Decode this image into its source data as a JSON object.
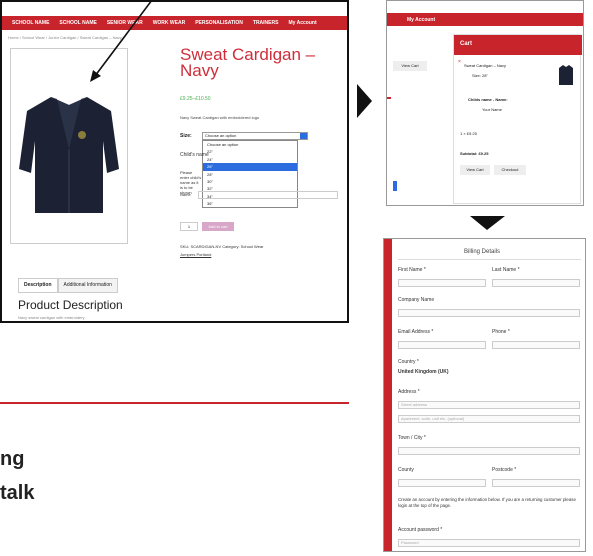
{
  "panel1": {
    "nav": [
      "SCHOOL NAME",
      "SCHOOL NAME",
      "SENIOR WEAR",
      "WORK WEAR",
      "PERSONALISATION",
      "TRAINERS",
      "My Account"
    ],
    "breadcrumb": "Home / School Wear / Junior Cardigan / Sweat Cardigan – Navy",
    "product_title": "Sweat Cardigan – Navy",
    "price": "£9.25–£10.50",
    "short_desc": "Navy Sweat Cardigan with embroidered logo",
    "size_label": "Size:",
    "size_select_value": "Choose an option",
    "size_options": [
      "Choose an option",
      "22\"",
      "24\"",
      "26\"",
      "28\"",
      "30\"",
      "32\"",
      "34\"",
      "36\"",
      "38\""
    ],
    "childs_name_label": "Child's name",
    "please_note": "Please enter child's name as it is to be shown",
    "name_label": "Name",
    "qty_value": "1",
    "add_to_cart": "Add to cart",
    "sku_line": "SKU: SCARDIGAN-NV  Category: School Wear",
    "brand_link": "Jumpers Portland",
    "tabs": [
      "Description",
      "Additional Information"
    ],
    "product_desc_title": "Product Description",
    "product_desc_text": "Navy sweat cardigan with embroidery"
  },
  "panel2": {
    "nav_item": "My Account",
    "side_btn": "View Cart",
    "cart_title": "Cart",
    "cart_item_name": "Sweat Cardigan – Navy",
    "size_line": "Size: 28\"",
    "childs_name_line": "Childs name - Name:",
    "your_name": "Your Name",
    "qty_price": "1 × £9.25",
    "subtotal": "Subtotal: £9.25",
    "view_cart": "View Cart",
    "checkout": "Checkout"
  },
  "panel3": {
    "title": "Billing Details",
    "first_name": "First Name *",
    "last_name": "Last Name *",
    "company": "Company Name",
    "email": "Email Address *",
    "phone": "Phone *",
    "country_label": "Country *",
    "country_value": "United Kingdom (UK)",
    "address_label": "Address *",
    "street_ph": "Street address",
    "apartment_ph": "Apartment, suite, unit etc. (optional)",
    "town_label": "Town / City *",
    "county_label": "County",
    "postcode_label": "Postcode *",
    "account_text": "Create an account by entering the information below. If you are a returning customer please login at the top of the page.",
    "account_password": "Account password *",
    "password_ph": "Password"
  },
  "left_text": {
    "line1": "ng",
    "line2": "talk"
  },
  "colors": {
    "brand_red": "#c8242c",
    "title_red": "#cf2d3a",
    "price_green": "#4caf50",
    "select_blue": "#2d6cdf"
  }
}
